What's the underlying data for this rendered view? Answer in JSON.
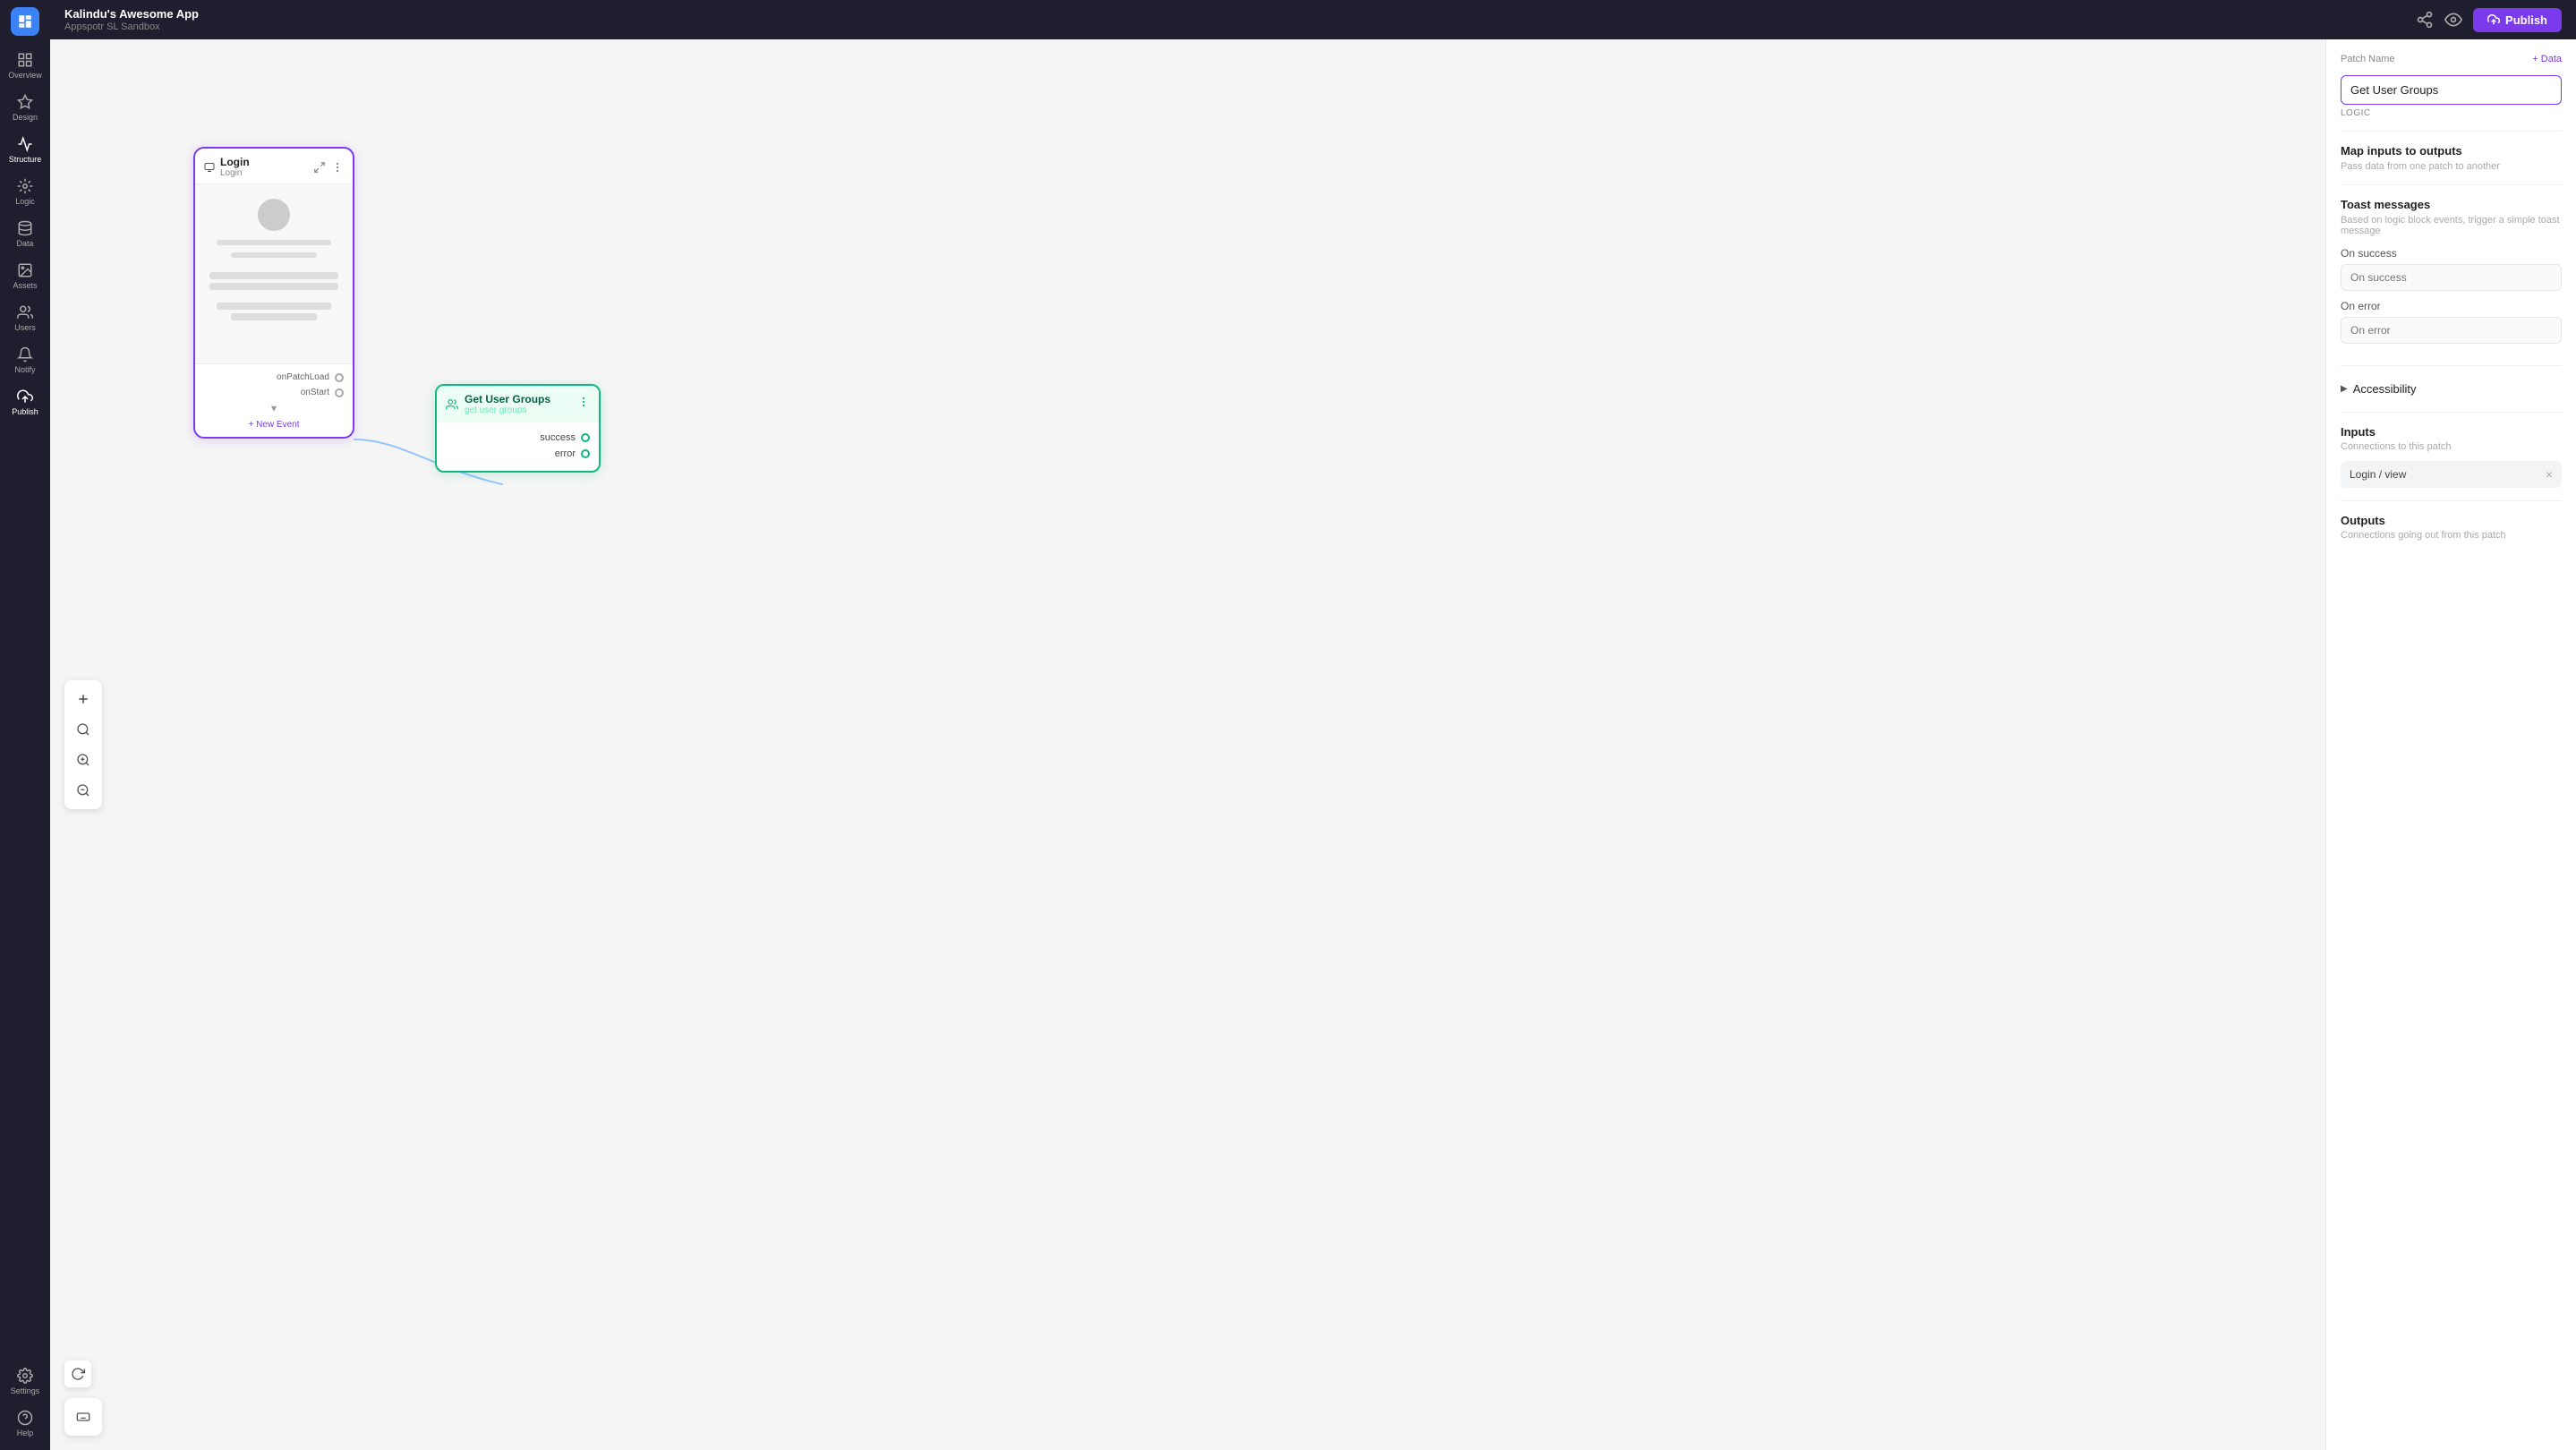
{
  "app": {
    "name": "Kalindu's Awesome App",
    "workspace": "Appspotr SL Sandbox"
  },
  "topbar": {
    "publish_label": "Publish"
  },
  "sidebar": {
    "items": [
      {
        "id": "overview",
        "label": "Overview",
        "active": false
      },
      {
        "id": "design",
        "label": "Design",
        "active": false
      },
      {
        "id": "structure",
        "label": "Structure",
        "active": true
      },
      {
        "id": "logic",
        "label": "Logic",
        "active": false
      },
      {
        "id": "data",
        "label": "Data",
        "active": false
      },
      {
        "id": "assets",
        "label": "Assets",
        "active": false
      },
      {
        "id": "users",
        "label": "Users",
        "active": false
      },
      {
        "id": "notify",
        "label": "Notify",
        "active": false
      },
      {
        "id": "publish",
        "label": "Publish",
        "active": false
      },
      {
        "id": "settings",
        "label": "Settings",
        "active": false
      }
    ],
    "bottom": [
      {
        "id": "help",
        "label": "Help"
      }
    ]
  },
  "login_node": {
    "title": "Login",
    "subtitle": "Login",
    "events": [
      {
        "label": "onPatchLoad"
      },
      {
        "label": "onStart"
      }
    ],
    "new_event_label": "+ New Event"
  },
  "ug_node": {
    "title": "Get User Groups",
    "subtitle": "get user groups",
    "outputs": [
      {
        "label": "success"
      },
      {
        "label": "error"
      }
    ]
  },
  "right_panel": {
    "patch_name_label": "Patch Name",
    "add_data_label": "+ Data",
    "patch_name_value": "Get User Groups",
    "logic_tag": "LOGIC",
    "map_inputs": {
      "title": "Map inputs to outputs",
      "sub": "Pass data from one patch to another"
    },
    "toast": {
      "title": "Toast messages",
      "sub": "Based on logic block events, trigger a simple toast message",
      "on_success_label": "On success",
      "on_success_placeholder": "On success",
      "on_error_label": "On error",
      "on_error_placeholder": "On error"
    },
    "accessibility": {
      "label": "Accessibility"
    },
    "inputs": {
      "title": "Inputs",
      "sub": "Connections to this patch",
      "items": [
        {
          "label": "Login / view"
        }
      ]
    },
    "outputs": {
      "title": "Outputs",
      "sub": "Connections going out from this patch"
    }
  }
}
